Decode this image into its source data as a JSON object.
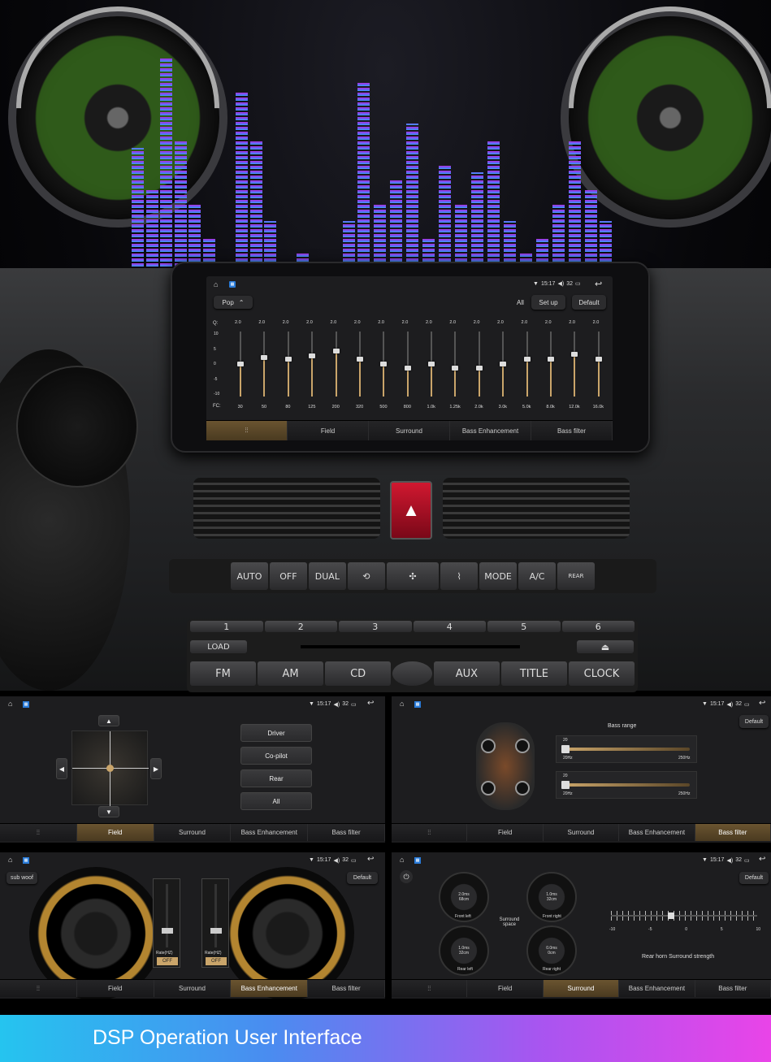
{
  "main": {
    "status": {
      "time": "15:17",
      "volume": "32"
    },
    "preset": "Pop",
    "all_label": "All",
    "setup_label": "Set up",
    "default_label": "Default",
    "q_label": "Q:",
    "fc_label": "FC:",
    "scale": [
      "10",
      "5",
      "0",
      "-5",
      "-10"
    ],
    "q_values": [
      "2.0",
      "2.0",
      "2.0",
      "2.0",
      "2.0",
      "2.0",
      "2.0",
      "2.0",
      "2.0",
      "2.0",
      "2.0",
      "2.0",
      "2.0",
      "2.0",
      "2.0",
      "2.0"
    ],
    "frequencies": [
      "30",
      "50",
      "80",
      "125",
      "200",
      "320",
      "500",
      "800",
      "1.0k",
      "1.25k",
      "2.0k",
      "3.0k",
      "5.0k",
      "8.0k",
      "12.0k",
      "16.0k"
    ],
    "levels": [
      0.5,
      0.6,
      0.58,
      0.62,
      0.7,
      0.58,
      0.5,
      0.44,
      0.5,
      0.44,
      0.44,
      0.5,
      0.58,
      0.58,
      0.65,
      0.58
    ],
    "tabs": [
      "Field",
      "Surround",
      "Bass Enhancement",
      "Bass filter"
    ]
  },
  "car": {
    "climate": [
      "AUTO",
      "OFF",
      "DUAL",
      "MODE",
      "A/C",
      "REAR"
    ],
    "presets": [
      "1",
      "2",
      "3",
      "4",
      "5",
      "6"
    ],
    "load": "LOAD",
    "sources": [
      "FM",
      "AM",
      "CD",
      "AUX",
      "TITLE",
      "CLOCK"
    ]
  },
  "field_panel": {
    "buttons": [
      "Driver",
      "Co-pilot",
      "Rear",
      "All"
    ],
    "tabs": [
      "Field",
      "Surround",
      "Bass Enhancement",
      "Bass filter"
    ]
  },
  "bassfilter_panel": {
    "default_label": "Default",
    "title": "Bass range",
    "slider1": {
      "value": "20",
      "min": "20Hz",
      "max": "250Hz"
    },
    "slider2": {
      "value": "20",
      "min": "20Hz",
      "max": "250Hz"
    },
    "tabs": [
      "Field",
      "Surround",
      "Bass Enhancement",
      "Bass filter"
    ]
  },
  "bass_panel": {
    "subwoof_label": "sub woof",
    "default_label": "Default",
    "rate_label": "Rate(HZ)",
    "off_label": "OFF",
    "tabs": [
      "Field",
      "Surround",
      "Bass Enhancement",
      "Bass filter"
    ]
  },
  "surround_panel": {
    "default_label": "Default",
    "dials": [
      {
        "value": "2.0ms",
        "sub": "68cm",
        "label": "Front left"
      },
      {
        "value": "1.0ms",
        "sub": "32cm",
        "label": "Front right"
      },
      {
        "value": "1.0ms",
        "sub": "32cm",
        "label": "Rear left"
      },
      {
        "value": "0.0ms",
        "sub": "0cm",
        "label": "Rear right"
      }
    ],
    "space_label": "Surround space",
    "scale": [
      "-10",
      "-5",
      "0",
      "5",
      "10"
    ],
    "strength_label": "Rear horn Surround strength",
    "tabs": [
      "Field",
      "Surround",
      "Bass Enhancement",
      "Bass filter"
    ]
  },
  "footer": {
    "title": "DSP Operation User Interface"
  },
  "colors": {
    "accent": "#caa56a",
    "tab_active": "#5a4628",
    "panel": "#1d1d1f",
    "footer_start": "#25c4ef",
    "footer_end": "#e944e8"
  }
}
